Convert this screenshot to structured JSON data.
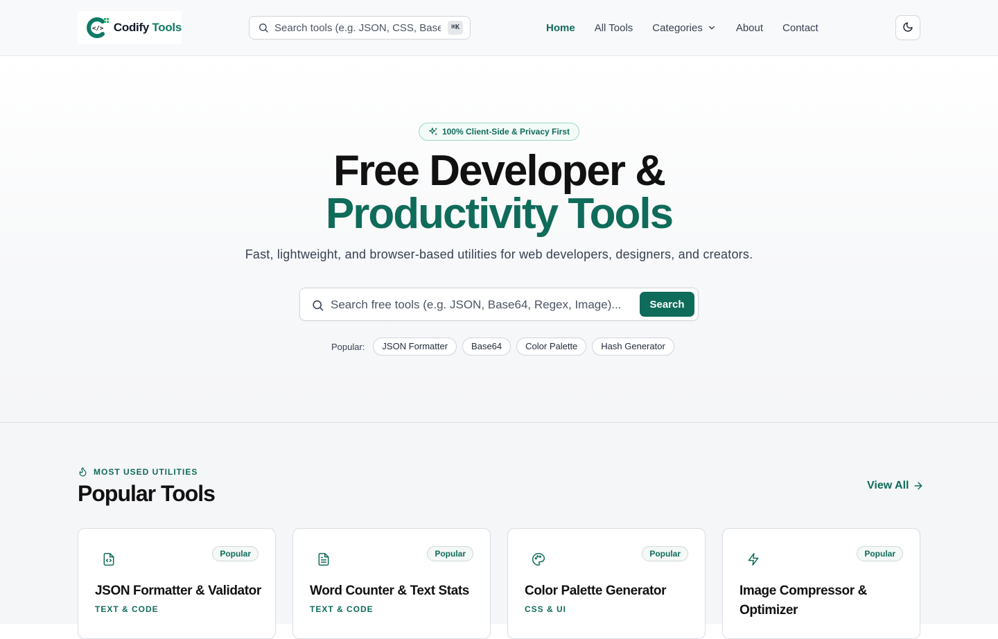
{
  "header": {
    "logo": {
      "name": "Codify",
      "accent": "Tools"
    },
    "search": {
      "placeholder": "Search tools (e.g. JSON, CSS, Base",
      "shortcut": "⌘K"
    },
    "nav": [
      {
        "label": "Home",
        "active": true
      },
      {
        "label": "All Tools"
      },
      {
        "label": "Categories",
        "dropdown": true
      },
      {
        "label": "About"
      },
      {
        "label": "Contact"
      }
    ],
    "theme_toggle_icon": "moon-icon"
  },
  "hero": {
    "badge": "100% Client-Side & Privacy First",
    "title_line1": "Free Developer &",
    "title_line2": "Productivity Tools",
    "subtitle": "Fast, lightweight, and browser-based utilities for web developers, designers, and creators.",
    "search": {
      "placeholder": "Search free tools (e.g. JSON, Base64, Regex, Image)...",
      "button": "Search"
    },
    "popular_label": "Popular:",
    "popular_chips": [
      "JSON Formatter",
      "Base64",
      "Color Palette",
      "Hash Generator"
    ]
  },
  "popular_section": {
    "eyebrow": "MOST USED UTILITIES",
    "title": "Popular Tools",
    "view_all": "View All",
    "cards": [
      {
        "title": "JSON Formatter & Validator",
        "category": "TEXT & CODE",
        "badge": "Popular",
        "icon": "file-code-icon"
      },
      {
        "title": "Word Counter & Text Stats",
        "category": "TEXT & CODE",
        "badge": "Popular",
        "icon": "file-text-icon"
      },
      {
        "title": "Color Palette Generator",
        "category": "CSS & UI",
        "badge": "Popular",
        "icon": "palette-icon"
      },
      {
        "title": "Image Compressor & Optimizer",
        "category": "",
        "badge": "Popular",
        "icon": "zap-icon"
      }
    ]
  },
  "colors": {
    "brand": "#0f6b5a",
    "brand_light": "#2bb673",
    "text": "#111111",
    "muted": "#374151",
    "border": "#d9dde3"
  }
}
